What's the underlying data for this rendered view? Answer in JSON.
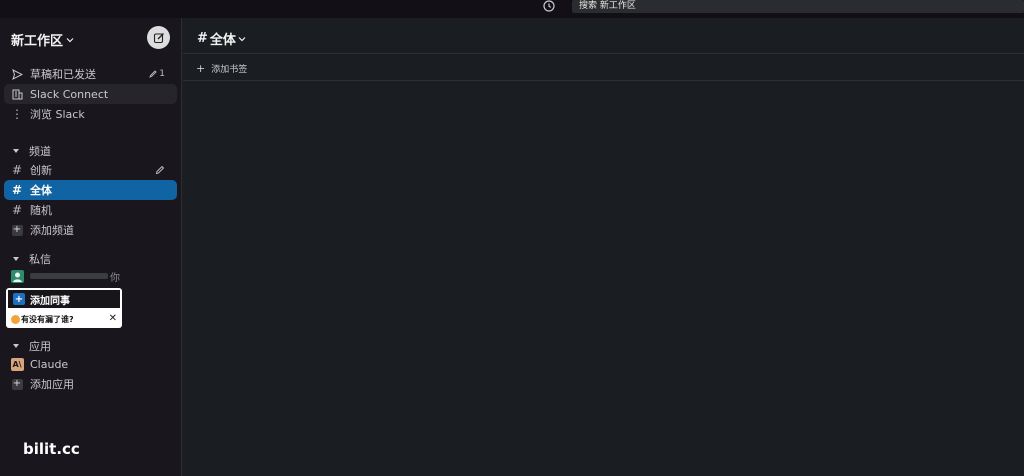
{
  "search": {
    "text": "搜索 新工作区"
  },
  "workspace": {
    "name": "新工作区"
  },
  "sidebar": {
    "top_items": [
      {
        "label": "草稿和已发送",
        "count": "1"
      },
      {
        "label": "Slack Connect"
      },
      {
        "label": "浏览 Slack"
      }
    ],
    "channels_header": "频道",
    "channels": [
      {
        "label": "创新"
      },
      {
        "label": "全体"
      },
      {
        "label": "随机"
      }
    ],
    "add_channel": "添加频道",
    "dm_header": "私信",
    "dm_self_suffix": "你",
    "apps_header": "应用",
    "apps": [
      {
        "label": "Claude"
      }
    ],
    "add_app": "添加应用"
  },
  "popup": {
    "add_colleague": "添加同事",
    "prompt": "有没有漏了谁?"
  },
  "watermark": "bilit.cc",
  "channel": {
    "title": "全体",
    "add_bookmark": "添加书签"
  },
  "colors": {
    "active": "#1164a3",
    "sidebar_bg": "#19171d",
    "main_bg": "#1a1d21"
  }
}
